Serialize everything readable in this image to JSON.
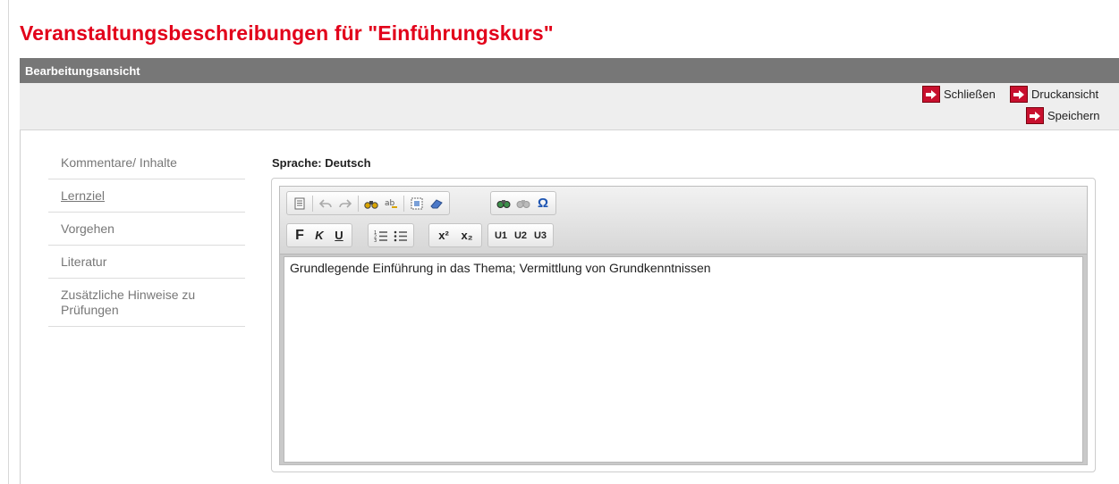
{
  "page": {
    "title": "Veranstaltungsbeschreibungen für \"Einführungskurs\""
  },
  "header": {
    "label": "Bearbeitungsansicht"
  },
  "actions": {
    "close": "Schließen",
    "print": "Druckansicht",
    "save": "Speichern"
  },
  "nav": {
    "items": [
      {
        "label": "Kommentare/ Inhalte"
      },
      {
        "label": "Lernziel"
      },
      {
        "label": "Vorgehen"
      },
      {
        "label": "Literatur"
      },
      {
        "label": "Zusätzliche Hinweise zu Prüfungen"
      }
    ]
  },
  "editor": {
    "language_label": "Sprache: Deutsch",
    "content": "Grundlegende Einführung in das Thema; Vermittlung von Grundkenntnissen",
    "toolbar": {
      "bold": "F",
      "italic": "K",
      "underline": "U",
      "superscript": "x²",
      "subscript": "x₂",
      "h1": "U1",
      "h2": "U2",
      "h3": "U3",
      "special_char": "Ω"
    }
  },
  "colors": {
    "title": "#e2001a",
    "header_bar": "#777777",
    "action_button": "#c8102e"
  }
}
